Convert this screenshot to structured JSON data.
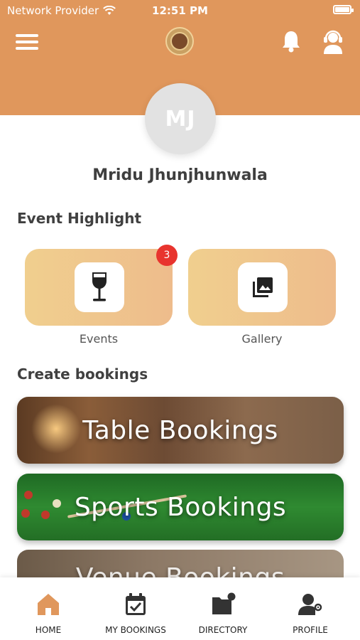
{
  "status_bar": {
    "carrier": "Network Provider",
    "time": "12:51 PM",
    "battery_level": 1.0
  },
  "header": {
    "menu_icon": "hamburger-menu-icon",
    "logo": "club-crest-logo",
    "notification_icon": "bell-icon",
    "support_icon": "support-headset-icon"
  },
  "profile": {
    "initials": "MJ",
    "name": "Mridu Jhunjhunwala"
  },
  "event_highlight": {
    "title": "Event Highlight",
    "tiles": [
      {
        "label": "Events",
        "icon": "wine-glass-icon",
        "badge": "3"
      },
      {
        "label": "Gallery",
        "icon": "photo-gallery-icon"
      }
    ]
  },
  "create_bookings": {
    "title": "Create bookings",
    "items": [
      {
        "label": "Table Bookings"
      },
      {
        "label": "Sports Bookings"
      },
      {
        "label": "Venue Bookings"
      }
    ]
  },
  "bottom_nav": {
    "items": [
      {
        "label": "HOME",
        "icon": "home-icon",
        "active": true
      },
      {
        "label": "MY BOOKINGS",
        "icon": "calendar-check-icon",
        "active": false
      },
      {
        "label": "DIRECTORY",
        "icon": "directory-folder-icon",
        "active": false
      },
      {
        "label": "PROFILE",
        "icon": "profile-settings-icon",
        "active": false
      }
    ]
  },
  "colors": {
    "header_bg": "#e0975c",
    "tile_gradient_start": "#f0cf8e",
    "tile_gradient_end": "#eebc8c",
    "badge": "#e8342e",
    "nav_active": "#e0975c"
  }
}
